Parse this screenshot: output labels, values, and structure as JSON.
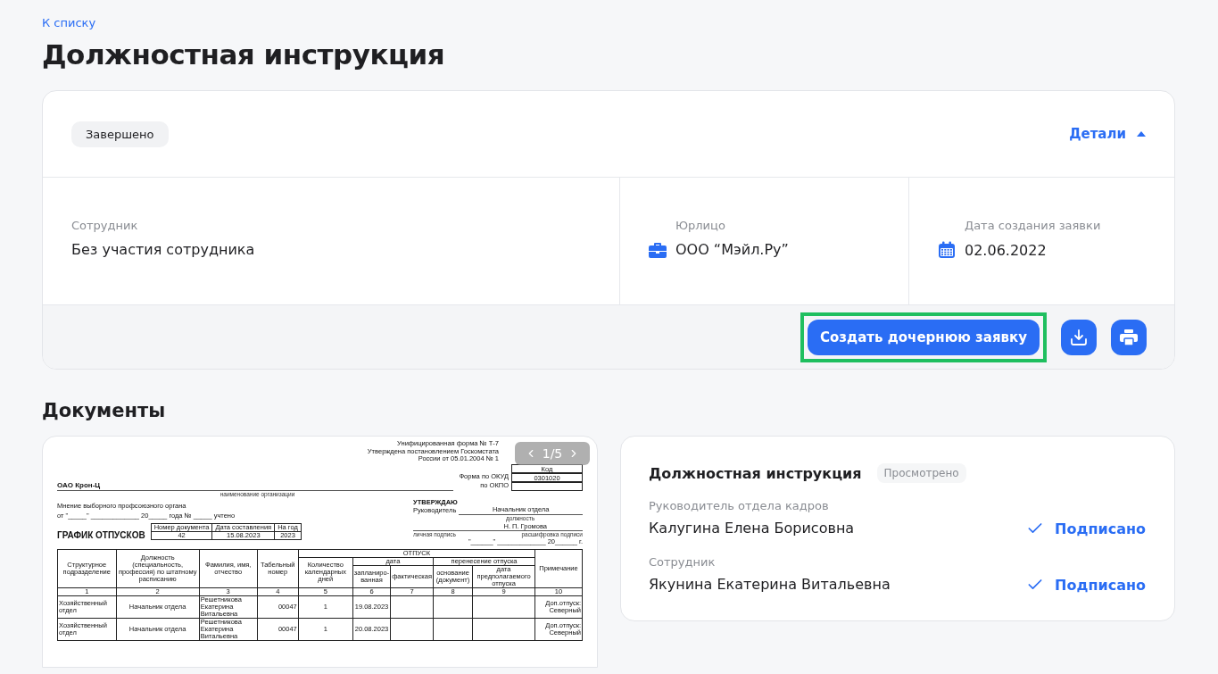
{
  "breadcrumb": "К списку",
  "title": "Должностная инструкция",
  "request": {
    "status": "Завершено",
    "details_label": "Детали",
    "details_expanded": true,
    "fields": [
      {
        "kind": "plain",
        "label": "Сотрудник",
        "value": "Без участия сотрудника"
      },
      {
        "kind": "company",
        "label": "Юрлицо",
        "value": "ООО “Мэйл.Ру”"
      },
      {
        "kind": "date",
        "label": "Дата создания заявки",
        "value": "02.06.2022"
      }
    ],
    "create_button": "Создать дочернюю заявку",
    "create_highlighted": true
  },
  "documents_title": "Документы",
  "preview": {
    "pager": "1/5",
    "form_lines": [
      "Унифицированная форма № Т-7",
      "Утверждена постановлением Госкомстата",
      "России от 05.01.2004 № 1"
    ],
    "code_header": "Код",
    "okud_label": "Форма по ОКУД",
    "okud_code": "0301020",
    "okpo_label": "по ОКПО",
    "org": "ОАО Крон-Ц",
    "org_caption": "наименование организации",
    "union_lines": [
      "Мнение выборного профсоюзного органа",
      "от \"_____\" _____________ 20_____ года № _____ учтено"
    ],
    "approve_title": "УТВЕРЖДАЮ",
    "approve_role": "Руководитель",
    "approve_position": "Начальник отдела",
    "position_caption": "должность",
    "approve_name": "Н. П. Громова",
    "signature_caption": "личная подпись",
    "name_caption": "расшифровка подписи",
    "date_line": "\"______\" _____________ 20______ г.",
    "doc_title": "ГРАФИК ОТПУСКОВ",
    "meta_headers": [
      "Номер документа",
      "Дата составления",
      "На год"
    ],
    "meta_values": [
      "42",
      "15.08.2023",
      "2023"
    ],
    "left_headers": [
      "Структурное подразделение",
      "Должность (специальность, профессия) по штатному расписанию",
      "Фамилия, имя, отчество",
      "Табельный номер"
    ],
    "group_header": "ОТПУСК",
    "days_header": "Количество календарных дней",
    "date_group": "дата",
    "date_headers": [
      "запланиро-ванная",
      "фактическая"
    ],
    "move_group": "перенесение отпуска",
    "move_headers": [
      "основание (документ)",
      "дата предполагаемого отпуска"
    ],
    "note_header": "Примечание",
    "numbers": [
      "1",
      "2",
      "3",
      "4",
      "5",
      "6",
      "7",
      "8",
      "9",
      "10"
    ],
    "rows": [
      {
        "department": "Хозяйственный отдел",
        "position": "Начальник отдела",
        "name": "Решетникова Екатерина Витальевна",
        "number": "00047",
        "days": "1",
        "planned": "19.08.2023",
        "note": "Доп.отпуск: Северный"
      },
      {
        "department": "Хозяйственный отдел",
        "position": "Начальник отдела",
        "name": "Решетникова Екатерина Витальевна",
        "number": "00047",
        "days": "1",
        "planned": "20.08.2023",
        "note": "Доп.отпуск: Северный"
      }
    ]
  },
  "signing": {
    "title": "Должностная инструкция",
    "badge": "Просмотрено",
    "signers": [
      {
        "role": "Руководитель отдела кадров",
        "name": "Калугина Елена Борисовна",
        "status": "Подписано",
        "signed": true
      },
      {
        "role": "Сотрудник",
        "name": "Якунина Екатерина Витальевна",
        "status": "Подписано",
        "signed": true
      }
    ]
  }
}
